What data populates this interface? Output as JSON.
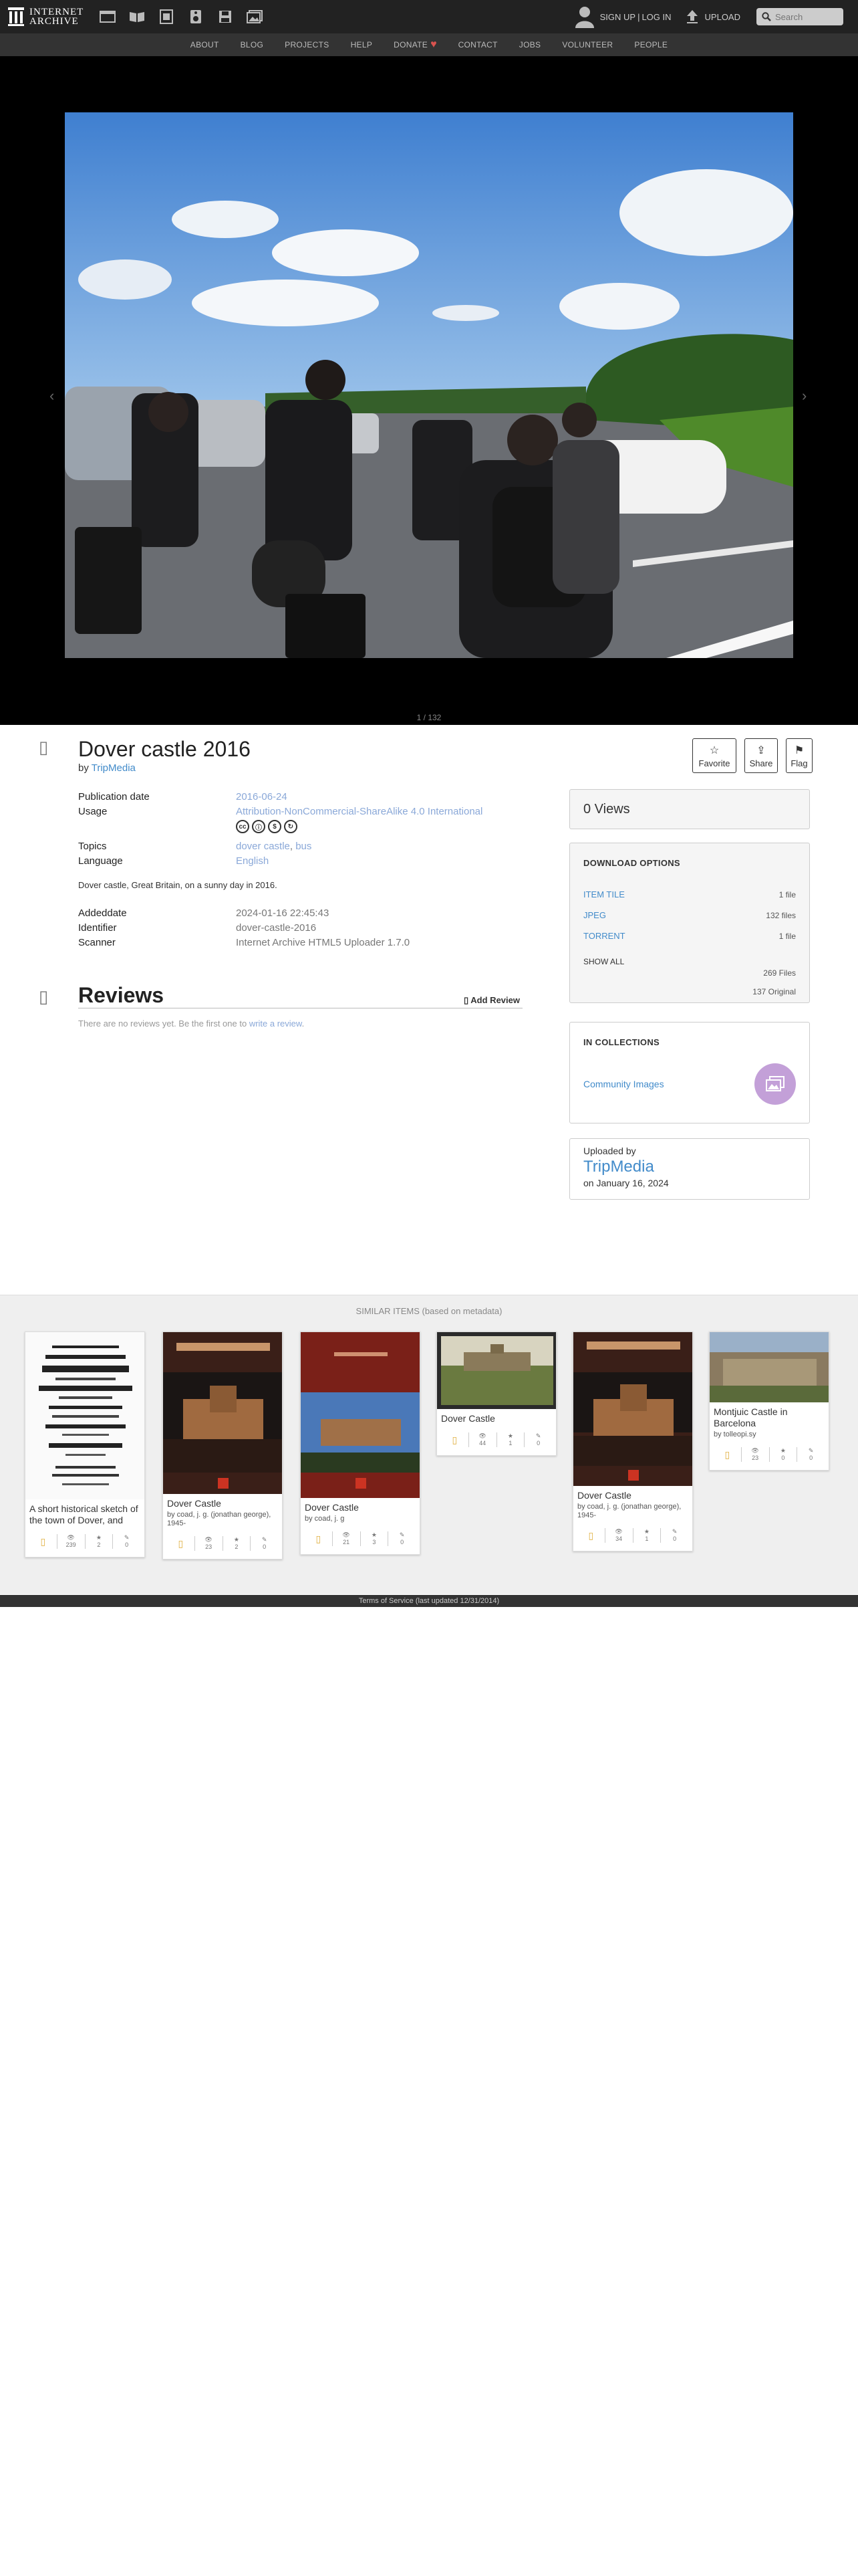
{
  "brand": {
    "line1": "INTERNET",
    "line2": "ARCHIVE"
  },
  "topnav": {
    "media": [
      "web-icon",
      "texts-icon",
      "video-icon",
      "audio-icon",
      "software-icon",
      "images-icon"
    ],
    "signup": "SIGN UP",
    "separator": "|",
    "login": "LOG IN",
    "upload": "UPLOAD",
    "search_placeholder": "Search"
  },
  "subnav": [
    "ABOUT",
    "BLOG",
    "PROJECTS",
    "HELP",
    "DONATE",
    "CONTACT",
    "JOBS",
    "VOLUNTEER",
    "PEOPLE"
  ],
  "theatre": {
    "page_count": "1 / 132",
    "prev": "‹",
    "next": "›"
  },
  "item": {
    "title": "Dover castle 2016",
    "by_prefix": "by",
    "creator": "TripMedia",
    "actions": {
      "favorite": "Favorite",
      "share": "Share",
      "flag": "Flag"
    },
    "metadata": {
      "pubdate_label": "Publication date",
      "pubdate": "2016-06-24",
      "usage_label": "Usage",
      "usage": "Attribution-NonCommercial-ShareAlike 4.0 International",
      "cc_icons": [
        "cc",
        "by",
        "nc",
        "sa"
      ],
      "topics_label": "Topics",
      "topic1": "dover castle",
      "topic_sep": ",",
      "topic2": "bus",
      "language_label": "Language",
      "language": "English"
    },
    "description": "Dover castle, Great Britain, on a sunny day in 2016.",
    "extra": {
      "addeddate_label": "Addeddate",
      "addeddate": "2024-01-16 22:45:43",
      "identifier_label": "Identifier",
      "identifier": "dover-castle-2016",
      "scanner_label": "Scanner",
      "scanner": "Internet Archive HTML5 Uploader 1.7.0"
    }
  },
  "reviews": {
    "title": "Reviews",
    "add": "Add Review",
    "empty_text": "There are no reviews yet. Be the first one to",
    "write_link": "write a review",
    "period": "."
  },
  "sidebar": {
    "views": "0 Views",
    "download_title": "DOWNLOAD OPTIONS",
    "downloads": [
      {
        "name": "ITEM TILE",
        "count": "1 file"
      },
      {
        "name": "JPEG",
        "count": "132 files"
      },
      {
        "name": "TORRENT",
        "count": "1 file"
      }
    ],
    "show_all": "SHOW ALL",
    "total_files": "269 Files",
    "original_files": "137 Original",
    "collections_title": "IN COLLECTIONS",
    "collection": "Community Images",
    "uploaded_by_label": "Uploaded by",
    "uploader": "TripMedia",
    "uploaded_on": "on January 16, 2024"
  },
  "similar": {
    "title": "SIMILAR ITEMS (based on metadata)",
    "cards": [
      {
        "title": "A short historical sketch of the town of Dover, and",
        "by": "",
        "views": "239",
        "favs": "2",
        "reviews": "0"
      },
      {
        "title": "Dover Castle",
        "by": "by coad, j. g. (jonathan george), 1945-",
        "views": "23",
        "favs": "2",
        "reviews": "0"
      },
      {
        "title": "Dover Castle",
        "by": "by coad, j. g",
        "views": "21",
        "favs": "3",
        "reviews": "0"
      },
      {
        "title": "Dover Castle",
        "by": "",
        "views": "44",
        "favs": "1",
        "reviews": "0"
      },
      {
        "title": "Dover Castle",
        "by": "by coad, j. g. (jonathan george), 1945-",
        "views": "34",
        "favs": "1",
        "reviews": "0"
      },
      {
        "title": "Montjuic Castle in Barcelona",
        "by": "by tolleopi.sy",
        "views": "23",
        "favs": "0",
        "reviews": "0"
      }
    ]
  },
  "footer": "Terms of Service (last updated 12/31/2014)"
}
